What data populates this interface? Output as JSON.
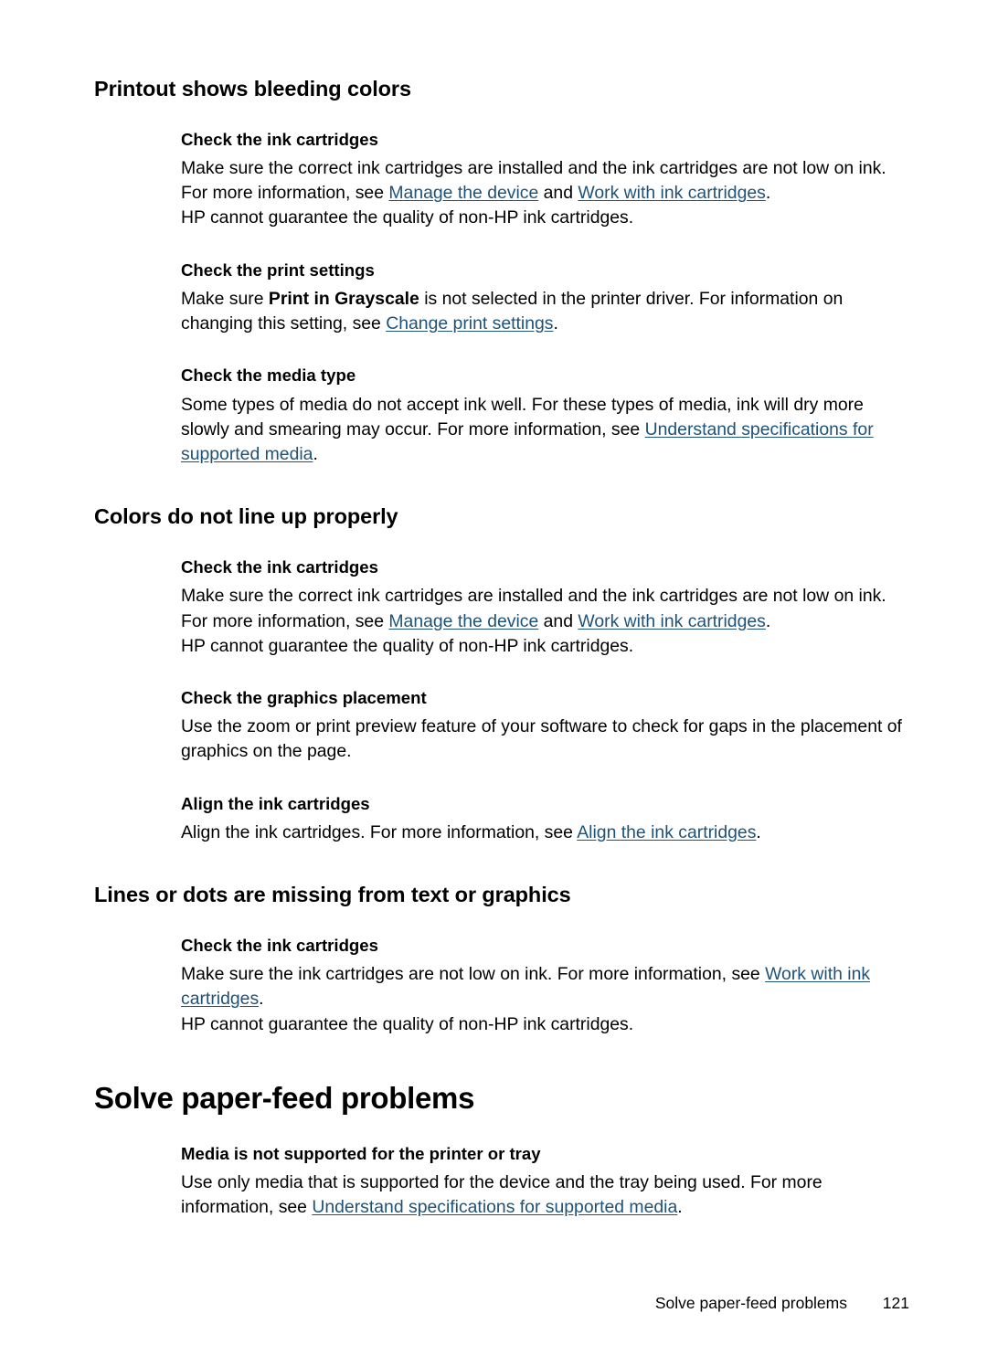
{
  "page": {
    "number": "121",
    "footer_label": "Solve paper-feed problems"
  },
  "sections": [
    {
      "id": "printout-shows-bleeding-colors",
      "title": "Printout shows bleeding colors",
      "level": "h2",
      "blocks": [
        {
          "id": "check-the-ink-cartridges",
          "subtitle": "Check the ink cartridges",
          "paragraphs": [
            {
              "runs": [
                {
                  "text": "Make sure the correct ink cartridges are installed and the ink cartridges are not low on ink. For more information, see "
                },
                {
                  "text": "Manage the device",
                  "link": true
                },
                {
                  "text": " and "
                },
                {
                  "text": "Work with ink cartridges",
                  "link": true
                },
                {
                  "text": "."
                }
              ]
            },
            {
              "runs": [
                {
                  "text": "HP cannot guarantee the quality of non-HP ink cartridges."
                }
              ]
            }
          ]
        },
        {
          "id": "check-the-print-settings",
          "subtitle": "Check the print settings",
          "paragraphs": [
            {
              "runs": [
                {
                  "text": "Make sure "
                },
                {
                  "text": "Print in Grayscale",
                  "bold": true
                },
                {
                  "text": " is not selected in the printer driver. For information on changing this setting, see "
                },
                {
                  "text": "Change print settings",
                  "link": true
                },
                {
                  "text": "."
                }
              ]
            }
          ]
        },
        {
          "id": "check-the-media-type",
          "subtitle": "Check the media type",
          "paragraphs": [
            {
              "runs": [
                {
                  "text": "Some types of media do not accept ink well. For these types of media, ink will dry more slowly and smearing may occur. For more information, see "
                },
                {
                  "text": "Understand specifications for supported media",
                  "link": true
                },
                {
                  "text": "."
                }
              ]
            }
          ]
        }
      ]
    },
    {
      "id": "colors-do-not-line-up-properly",
      "title": "Colors do not line up properly",
      "level": "h2",
      "blocks": [
        {
          "id": "check-the-ink-cartridges-2",
          "subtitle": "Check the ink cartridges",
          "paragraphs": [
            {
              "runs": [
                {
                  "text": "Make sure the correct ink cartridges are installed and the ink cartridges are not low on ink. For more information, see "
                },
                {
                  "text": "Manage the device",
                  "link": true
                },
                {
                  "text": " and "
                },
                {
                  "text": "Work with ink cartridges",
                  "link": true
                },
                {
                  "text": "."
                }
              ]
            },
            {
              "runs": [
                {
                  "text": "HP cannot guarantee the quality of non-HP ink cartridges."
                }
              ]
            }
          ]
        },
        {
          "id": "check-the-graphics-placement",
          "subtitle": "Check the graphics placement",
          "paragraphs": [
            {
              "runs": [
                {
                  "text": "Use the zoom or print preview feature of your software to check for gaps in the placement of graphics on the page."
                }
              ]
            }
          ]
        },
        {
          "id": "align-the-ink-cartridges",
          "subtitle": "Align the ink cartridges",
          "paragraphs": [
            {
              "runs": [
                {
                  "text": "Align the ink cartridges. For more information, see "
                },
                {
                  "text": "Align the ink cartridges",
                  "link": true
                },
                {
                  "text": "."
                }
              ]
            }
          ]
        }
      ]
    },
    {
      "id": "lines-or-dots-are-missing",
      "title": "Lines or dots are missing from text or graphics",
      "level": "h2",
      "blocks": [
        {
          "id": "check-the-ink-cartridges-3",
          "subtitle": "Check the ink cartridges",
          "paragraphs": [
            {
              "runs": [
                {
                  "text": "Make sure the ink cartridges are not low on ink. For more information, see "
                },
                {
                  "text": "Work with ink cartridges",
                  "link": true
                },
                {
                  "text": "."
                }
              ]
            },
            {
              "runs": [
                {
                  "text": "HP cannot guarantee the quality of non-HP ink cartridges."
                }
              ]
            }
          ]
        }
      ]
    },
    {
      "id": "solve-paper-feed-problems",
      "title": "Solve paper-feed problems",
      "level": "h1",
      "blocks": [
        {
          "id": "media-is-not-supported",
          "subtitle": "Media is not supported for the printer or tray",
          "paragraphs": [
            {
              "runs": [
                {
                  "text": "Use only media that is supported for the device and the tray being used. For more information, see "
                },
                {
                  "text": "Understand specifications for supported media",
                  "link": true
                },
                {
                  "text": "."
                }
              ]
            }
          ]
        }
      ]
    }
  ]
}
